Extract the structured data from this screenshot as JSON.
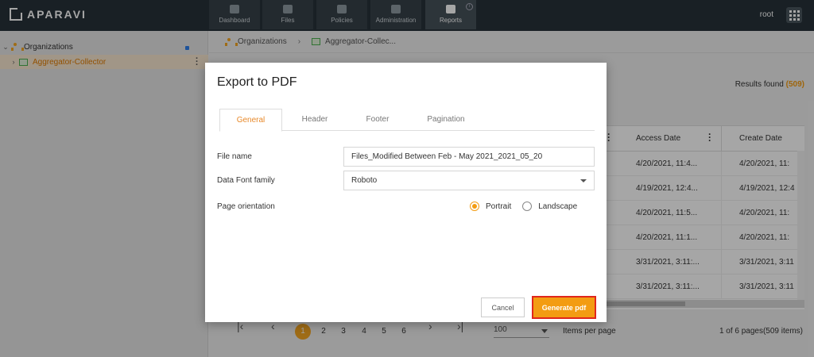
{
  "brand": {
    "name": "APARAVI"
  },
  "nav": [
    {
      "label": "Dashboard",
      "icon": "dashboard-icon"
    },
    {
      "label": "Files",
      "icon": "folder-icon"
    },
    {
      "label": "Policies",
      "icon": "gear-icon"
    },
    {
      "label": "Administration",
      "icon": "users-icon"
    },
    {
      "label": "Reports",
      "icon": "clipboard-icon"
    }
  ],
  "nav_active": "Reports",
  "user": {
    "name": "root"
  },
  "sidebar": {
    "organizations": "Organizations",
    "collector": "Aggregator-Collector"
  },
  "breadcrumb": {
    "root": "Organizations",
    "current": "Aggregator-Collec..."
  },
  "results": {
    "label": "Results found",
    "count": "(509)"
  },
  "table": {
    "headers": [
      "Access Date",
      "Create Date"
    ],
    "rows": [
      [
        "4/20/2021, 11:4...",
        "4/20/2021, 11:"
      ],
      [
        "4/19/2021, 12:4...",
        "4/19/2021, 12:4"
      ],
      [
        "4/20/2021, 11:5...",
        "4/20/2021, 11:"
      ],
      [
        "4/20/2021, 11:1...",
        "4/20/2021, 11:"
      ],
      [
        "3/31/2021, 3:11:...",
        "3/31/2021, 3:11"
      ],
      [
        "3/31/2021, 3:11:...",
        "3/31/2021, 3:11"
      ]
    ]
  },
  "pagination": {
    "pages": [
      "1",
      "2",
      "3",
      "4",
      "5",
      "6"
    ],
    "active_page": "1",
    "per_page": "100",
    "per_page_label": "Items per page",
    "info": "1 of 6 pages(509 items)"
  },
  "modal": {
    "title": "Export to PDF",
    "tabs": [
      "General",
      "Header",
      "Footer",
      "Pagination"
    ],
    "active_tab": "General",
    "file_name_label": "File name",
    "file_name_value": "Files_Modified Between Feb - May 2021_2021_05_20",
    "font_label": "Data Font family",
    "font_value": "Roboto",
    "orientation_label": "Page orientation",
    "orientation_options": [
      "Portrait",
      "Landscape"
    ],
    "orientation_selected": "Portrait",
    "cancel": "Cancel",
    "generate": "Generate pdf"
  },
  "colors": {
    "accent": "#f39c12",
    "topbar": "#27323a",
    "highlight_border": "#e0261c"
  }
}
